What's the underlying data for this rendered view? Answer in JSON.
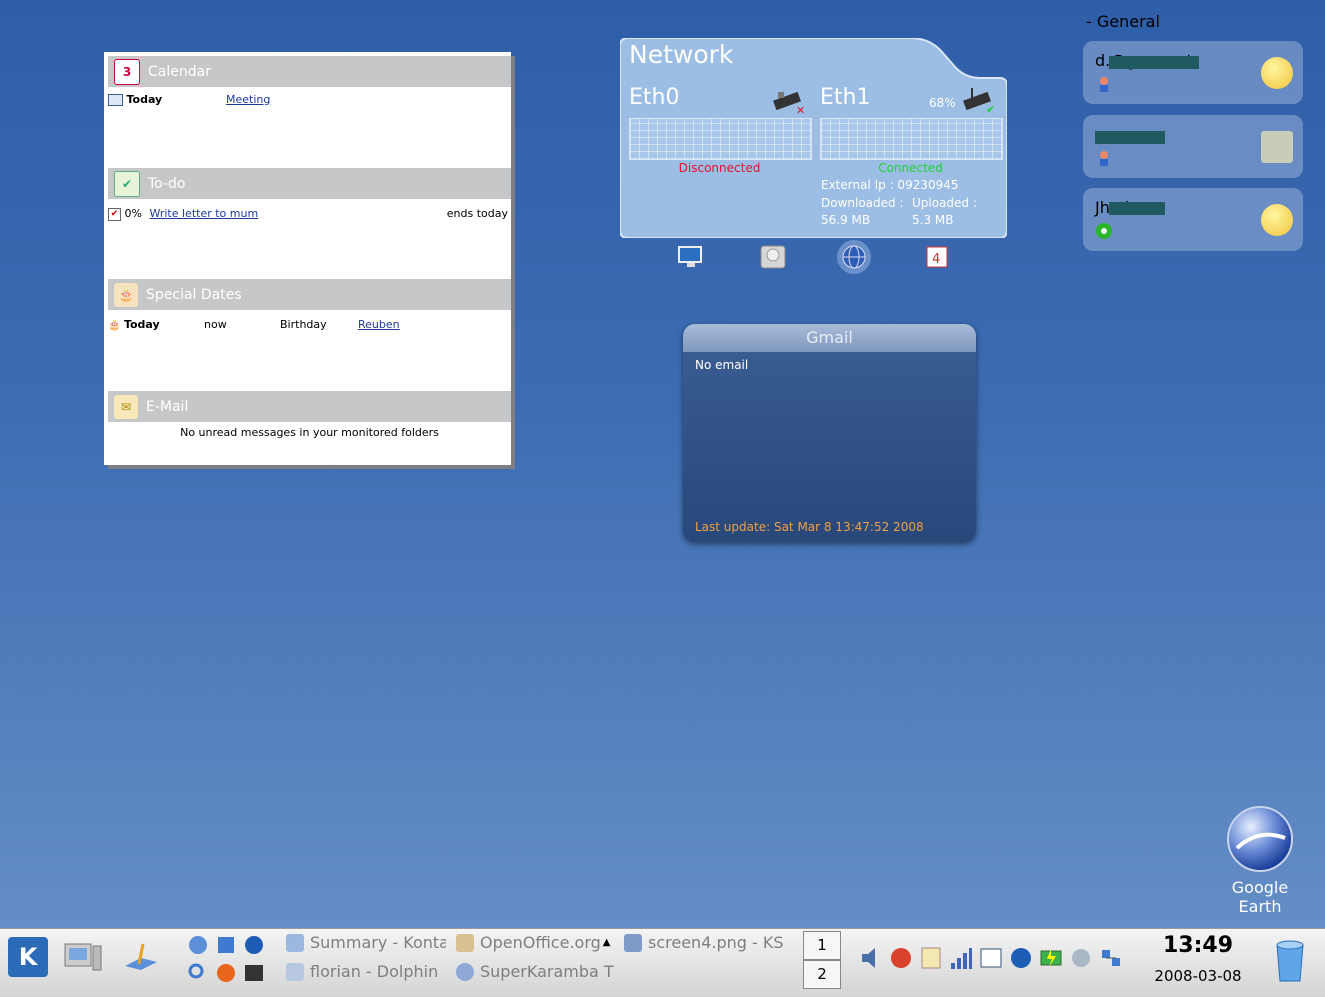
{
  "kontact": {
    "calendar": {
      "title": "Calendar",
      "day": "Today",
      "event": "Meeting"
    },
    "todo": {
      "title": "To-do",
      "percent": "0%",
      "item": "Write letter to mum",
      "due": "ends today"
    },
    "special": {
      "title": "Special Dates",
      "day": "Today",
      "when": "now",
      "type": "Birthday",
      "name": "Reuben"
    },
    "email": {
      "title": "E-Mail",
      "message": "No unread messages in your monitored folders"
    }
  },
  "network": {
    "title": "Network",
    "eth0": {
      "name": "Eth0",
      "status": "Disconnected"
    },
    "eth1": {
      "name": "Eth1",
      "signal": "68%",
      "status": "Connected"
    },
    "external_ip": "External Ip : 09230945",
    "downloaded_label": "Downloaded :",
    "uploaded_label": "Uploaded :",
    "downloaded": "56.9 MB",
    "uploaded": "5.3 MB"
  },
  "gmail": {
    "title": "Gmail",
    "status": "No email",
    "last_update": "Last update: Sat Mar  8 13:47:52 2008"
  },
  "contacts": {
    "group": "- General",
    "items": [
      {
        "name": "d.@gmx.net"
      },
      {
        "name": ""
      },
      {
        "name": "Jh...b"
      }
    ]
  },
  "desktop_icon": {
    "label_line1": "Google",
    "label_line2": "Earth"
  },
  "taskbar": {
    "tasks": [
      "Summary - Konta",
      "OpenOffice.org",
      "screen4.png - KS",
      "florian - Dolphin",
      "SuperKaramba T"
    ],
    "pager": [
      "1",
      "2"
    ],
    "clock": "13:49",
    "date": "2008-03-08"
  },
  "colors": {
    "disconnected": "#e0142a",
    "connected": "#1fd13a",
    "gmail_footer": "#f0a040"
  }
}
